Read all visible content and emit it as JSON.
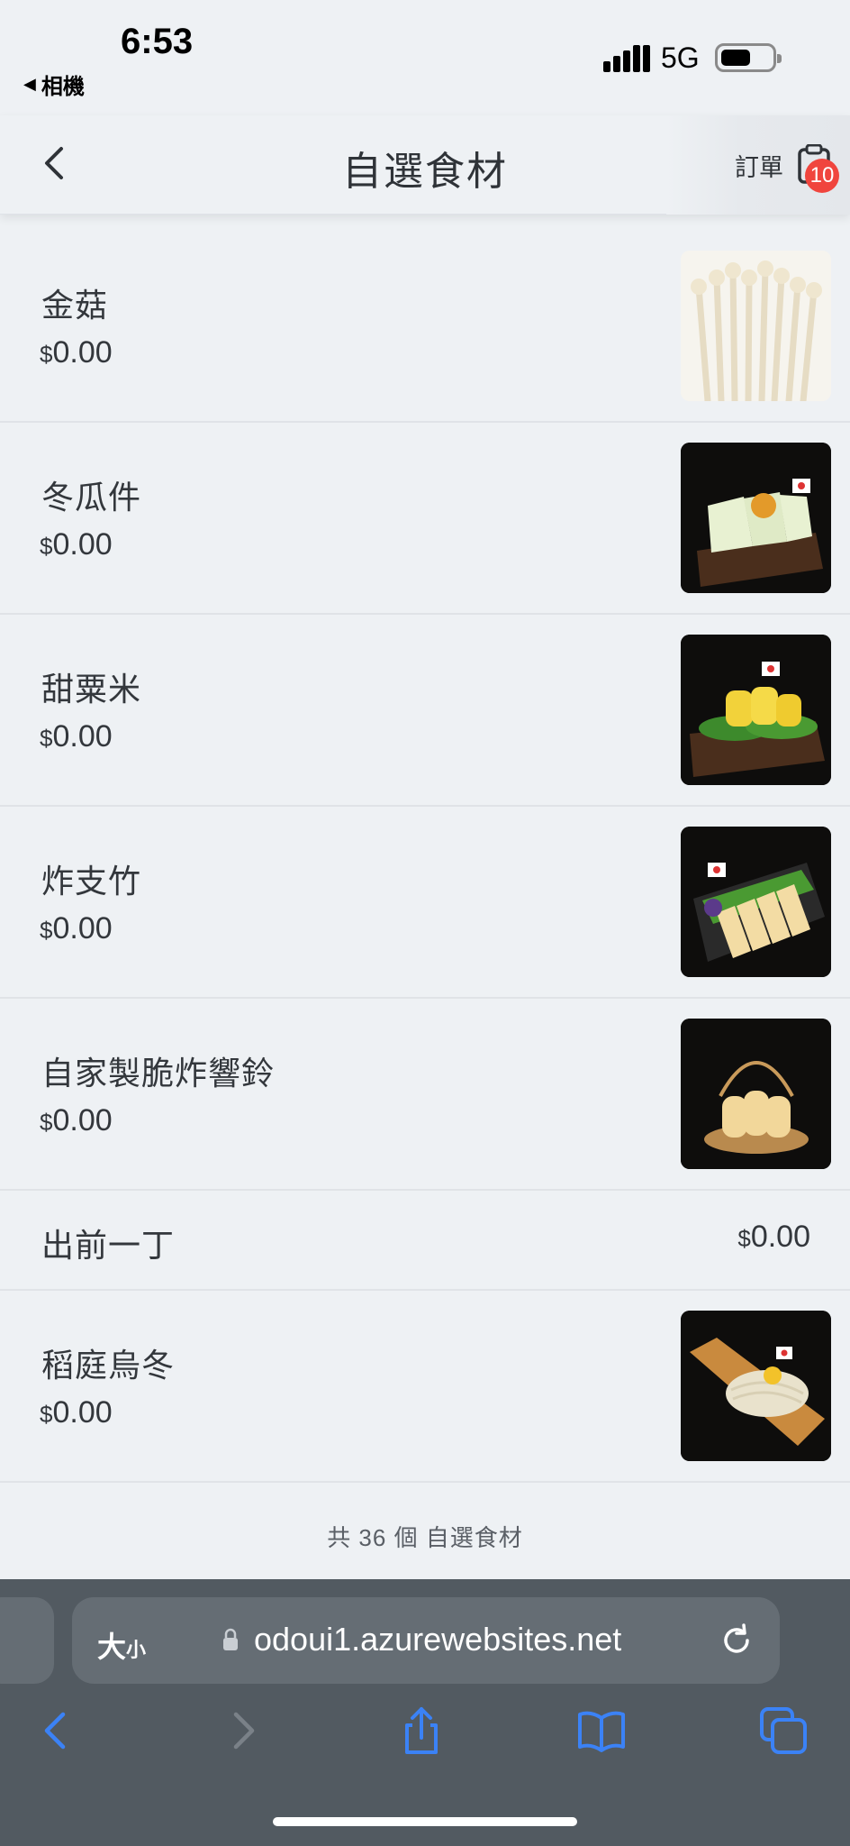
{
  "status_bar": {
    "time": "6:53",
    "back_app": "相機",
    "network": "5G"
  },
  "nav": {
    "title": "自選食材",
    "order_label": "訂單",
    "order_badge": "10"
  },
  "currency_symbol": "$",
  "items": [
    {
      "name": "金菇",
      "price": "0.00",
      "image": "enoki-mushroom"
    },
    {
      "name": "冬瓜件",
      "price": "0.00",
      "image": "winter-melon"
    },
    {
      "name": "甜粟米",
      "price": "0.00",
      "image": "sweet-corn"
    },
    {
      "name": "炸支竹",
      "price": "0.00",
      "image": "fried-beancurd-stick"
    },
    {
      "name": "自家製脆炸響鈴",
      "price": "0.00",
      "image": "crispy-beancurd-roll"
    },
    {
      "name": "出前一丁",
      "price": "0.00"
    },
    {
      "name": "稻庭烏冬",
      "price": "0.00",
      "image": "inaniwa-udon"
    }
  ],
  "footer": {
    "count_text": "共 36 個 自選食材"
  },
  "browser": {
    "aa_label": "大",
    "aa_small": "小",
    "url": "odoui1.azurewebsites.net"
  },
  "colors": {
    "background": "#eef1f4",
    "badge": "#f0453e",
    "toolbar": "#525a61",
    "toolbar_icon": "#3b82f6"
  }
}
